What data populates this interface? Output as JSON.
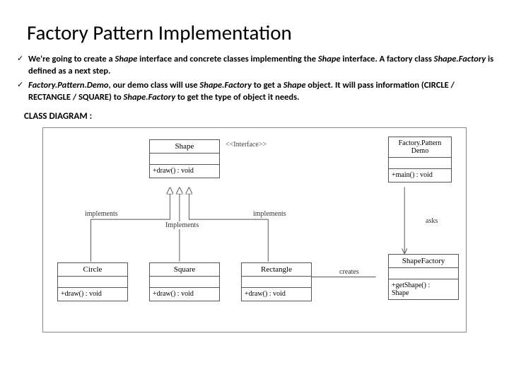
{
  "title": "Factory Pattern Implementation",
  "bullets": {
    "b1_pre": "We're going to create a ",
    "b1_i1": "Shape",
    "b1_mid1": " interface and concrete classes implementing the ",
    "b1_i2": "Shape",
    "b1_mid2": " interface. A factory class ",
    "b1_i3": "Shape.Factory",
    "b1_post": " is defined as a next step.",
    "b2_i1": "Factory.Pattern.Demo",
    "b2_mid1": ", our demo class will use ",
    "b2_i2": "Shape.Factory",
    "b2_mid2": " to get a ",
    "b2_i3": "Shape",
    "b2_mid3": " object. It will pass information (",
    "b2_opts": "CIRCLE / RECTANGLE / SQUARE",
    "b2_mid4": ") to ",
    "b2_i4": "Shape.Factory",
    "b2_post": " to get the type of object it needs."
  },
  "subheading": "CLASS DIAGRAM :",
  "uml": {
    "shape": {
      "name": "Shape",
      "op": "+draw() : void",
      "stereotype": "<<Interface>>"
    },
    "circle": {
      "name": "Circle",
      "op": "+draw() : void"
    },
    "square": {
      "name": "Square",
      "op": "+draw() : void"
    },
    "rectangle": {
      "name": "Rectangle",
      "op": "+draw() : void"
    },
    "demo": {
      "name": "Factory.Pattern\nDemo",
      "op": "+main() : void"
    },
    "factory": {
      "name": "ShapeFactory",
      "op": "+getShape() :\nShape"
    }
  },
  "edges": {
    "implements1": "implements",
    "implements2": "Implements",
    "implements3": "implements",
    "asks": "asks",
    "creates": "creates"
  }
}
